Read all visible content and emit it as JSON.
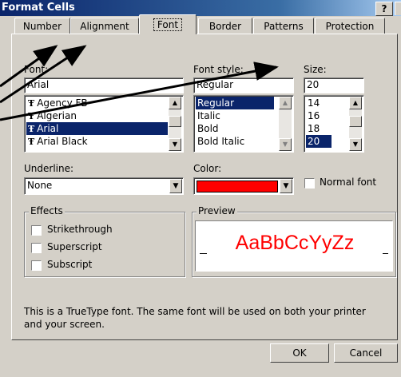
{
  "window": {
    "title": "Format Cells",
    "help_label": "?"
  },
  "tabs": [
    {
      "label": "Number"
    },
    {
      "label": "Alignment"
    },
    {
      "label": "Font"
    },
    {
      "label": "Border"
    },
    {
      "label": "Patterns"
    },
    {
      "label": "Protection"
    }
  ],
  "font": {
    "label": "Font:",
    "value": "Arial",
    "list": [
      {
        "label": "Agency FB"
      },
      {
        "label": "Algerian"
      },
      {
        "label": "Arial"
      },
      {
        "label": "Arial Black"
      }
    ],
    "selected_index": 2
  },
  "font_style": {
    "label": "Font style:",
    "value": "Regular",
    "list": [
      {
        "label": "Regular"
      },
      {
        "label": "Italic"
      },
      {
        "label": "Bold"
      },
      {
        "label": "Bold Italic"
      }
    ],
    "selected_index": 0
  },
  "size": {
    "label": "Size:",
    "value": "20",
    "list": [
      {
        "label": "14"
      },
      {
        "label": "16"
      },
      {
        "label": "18"
      },
      {
        "label": "20"
      }
    ],
    "selected_index": 3
  },
  "underline": {
    "label": "Underline:",
    "value": "None"
  },
  "color": {
    "label": "Color:",
    "swatch": "#ff0000"
  },
  "normal_font": {
    "label": "Normal font",
    "checked": false
  },
  "effects": {
    "label": "Effects",
    "items": [
      {
        "label": "Strikethrough",
        "checked": false
      },
      {
        "label": "Superscript",
        "checked": false
      },
      {
        "label": "Subscript",
        "checked": false
      }
    ]
  },
  "preview": {
    "label": "Preview",
    "sample": "AaBbCcYyZz",
    "color": "#ff0000"
  },
  "info_text": "This is a TrueType font.  The same font will be used on both your printer and your screen.",
  "buttons": {
    "ok": "OK",
    "cancel": "Cancel"
  },
  "icons": {
    "truetype": "truetype-font-icon",
    "dropdown": "dropdown-arrow-icon"
  }
}
